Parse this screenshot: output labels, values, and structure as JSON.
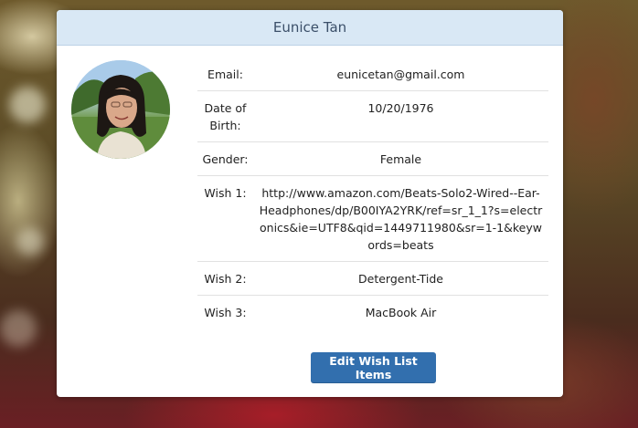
{
  "profile": {
    "name": "Eunice Tan",
    "fields": [
      {
        "label": "Email:",
        "value": "eunicetan@gmail.com"
      },
      {
        "label": "Date of Birth:",
        "value": "10/20/1976"
      },
      {
        "label": "Gender:",
        "value": "Female"
      },
      {
        "label": "Wish 1:",
        "value": "http://www.amazon.com/Beats-Solo2-Wired--Ear-Headphones/dp/B00IYA2YRK/ref=sr_1_1?s=electronics&ie=UTF8&qid=1449711980&sr=1-1&keywords=beats"
      },
      {
        "label": "Wish 2:",
        "value": "Detergent-Tide"
      },
      {
        "label": "Wish 3:",
        "value": "MacBook Air"
      }
    ]
  },
  "actions": {
    "edit_label": "Edit Wish List Items"
  },
  "colors": {
    "header_bg": "#d9e8f5",
    "button_bg": "#326fae"
  }
}
